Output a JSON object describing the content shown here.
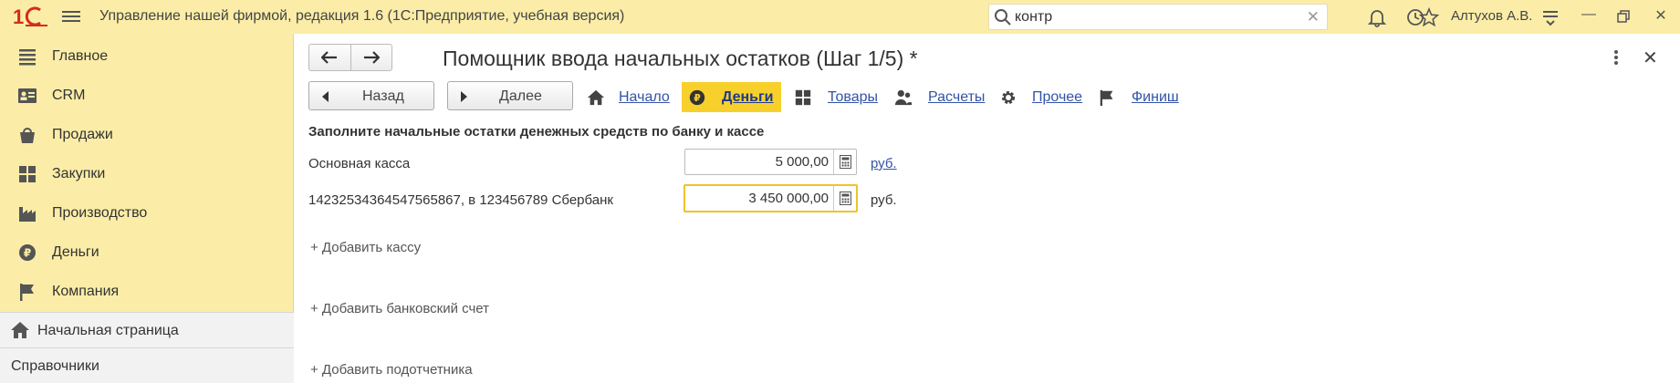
{
  "app": {
    "title": "Управление нашей фирмой, редакция 1.6  (1С:Предприятие, учебная версия)",
    "search_value": "контр",
    "user": "Алтухов А.В."
  },
  "sidebar": {
    "items": [
      {
        "label": "Главное",
        "icon": "list-icon"
      },
      {
        "label": "CRM",
        "icon": "contact-card-icon"
      },
      {
        "label": "Продажи",
        "icon": "shopping-bag-icon"
      },
      {
        "label": "Закупки",
        "icon": "warehouse-boxes-icon"
      },
      {
        "label": "Производство",
        "icon": "factory-icon"
      },
      {
        "label": "Деньги",
        "icon": "ruble-coin-icon"
      },
      {
        "label": "Компания",
        "icon": "flag-icon"
      }
    ],
    "home": "Начальная страница",
    "references": "Справочники"
  },
  "form": {
    "title": "Помощник ввода начальных остатков (Шаг 1/5) *",
    "back_button": "Назад",
    "next_button": "Далее",
    "steps": [
      {
        "label": "Начало",
        "icon": "home-icon"
      },
      {
        "label": "Деньги",
        "icon": "ruble-coin-icon",
        "active": true
      },
      {
        "label": "Товары",
        "icon": "boxes-icon"
      },
      {
        "label": "Расчеты",
        "icon": "people-icon"
      },
      {
        "label": "Прочее",
        "icon": "gear-icon"
      },
      {
        "label": "Финиш",
        "icon": "flag-icon"
      }
    ],
    "section_heading": "Заполните начальные остатки денежных средств по банку и кассе",
    "rows": [
      {
        "label": "Основная касса",
        "value": "5 000,00",
        "currency": "руб."
      },
      {
        "label": "14232534364547565867, в 123456789 Сбербанк",
        "value": "3 450 000,00",
        "currency": "руб."
      }
    ],
    "add_cash": "+ Добавить кассу",
    "add_bank": "+ Добавить банковский счет",
    "add_accountable": "+ Добавить подотчетника"
  },
  "colors": {
    "panel": "#fbeda7",
    "active_step": "#f8d02b",
    "link": "#3253a8",
    "logo_red": "#d52b1e"
  }
}
